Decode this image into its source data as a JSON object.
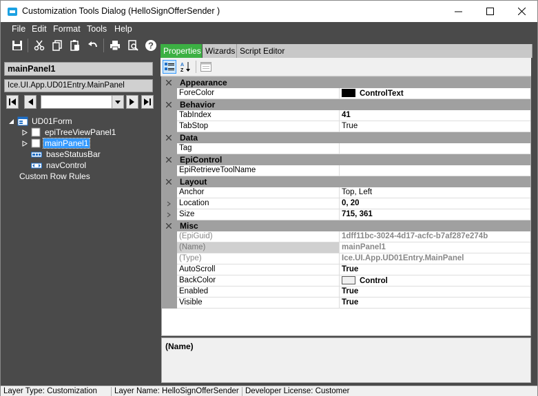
{
  "window": {
    "title": "Customization Tools Dialog  (HelloSignOfferSender )",
    "minimize_label": "—",
    "maximize_label": "☐",
    "close_label": "✕"
  },
  "menu": [
    "File",
    "Edit",
    "Format",
    "Tools",
    "Help"
  ],
  "toolbar": {
    "icons": [
      "save-icon",
      "cut-icon",
      "copy-icon",
      "paste-icon",
      "undo-icon",
      "print-icon",
      "print-preview-icon",
      "help-icon"
    ]
  },
  "left": {
    "selected_name": "mainPanel1",
    "selected_type": "Ice.UI.App.UD01Entry.MainPanel",
    "tree": {
      "root": "UD01Form",
      "children": [
        "epiTreeViewPanel1",
        "mainPanel1",
        "baseStatusBar",
        "navControl"
      ],
      "extra": "Custom Row Rules"
    }
  },
  "tabs": [
    "Properties",
    "Wizards",
    "Script Editor"
  ],
  "grid": {
    "categories": {
      "appearance": "Appearance",
      "behavior": "Behavior",
      "data": "Data",
      "epicontrol": "EpiControl",
      "layout": "Layout",
      "misc": "Misc"
    },
    "rows": {
      "forecolor": {
        "name": "ForeColor",
        "value": "ControlText",
        "swatch": "#000000"
      },
      "tabindex": {
        "name": "TabIndex",
        "value": "41"
      },
      "tabstop": {
        "name": "TabStop",
        "value": "True"
      },
      "tag": {
        "name": "Tag",
        "value": ""
      },
      "epiretrieve": {
        "name": "EpiRetrieveToolName",
        "value": ""
      },
      "anchor": {
        "name": "Anchor",
        "value": "Top, Left"
      },
      "location": {
        "name": "Location",
        "value": "0, 20"
      },
      "size": {
        "name": "Size",
        "value": "715, 361"
      },
      "epiguid": {
        "name": "(EpiGuid)",
        "value": "1dff11bc-3024-4d17-acfc-b7af287e274b"
      },
      "name": {
        "name": "(Name)",
        "value": "mainPanel1"
      },
      "type": {
        "name": "(Type)",
        "value": "Ice.UI.App.UD01Entry.MainPanel"
      },
      "autoscroll": {
        "name": "AutoScroll",
        "value": "True"
      },
      "backcolor": {
        "name": "BackColor",
        "value": "Control",
        "swatch": "#f0f0f0"
      },
      "enabled": {
        "name": "Enabled",
        "value": "True"
      },
      "visible": {
        "name": "Visible",
        "value": "True"
      }
    }
  },
  "description": {
    "title": "(Name)"
  },
  "status": {
    "layer_type": "Layer Type:  Customization",
    "layer_name": "Layer Name:  HelloSignOfferSender",
    "license": "Developer License:  Customer"
  },
  "colors": {
    "accent_tab": "#3cb043",
    "dark_panel": "#4a4a4a",
    "selection": "#3399ff"
  }
}
